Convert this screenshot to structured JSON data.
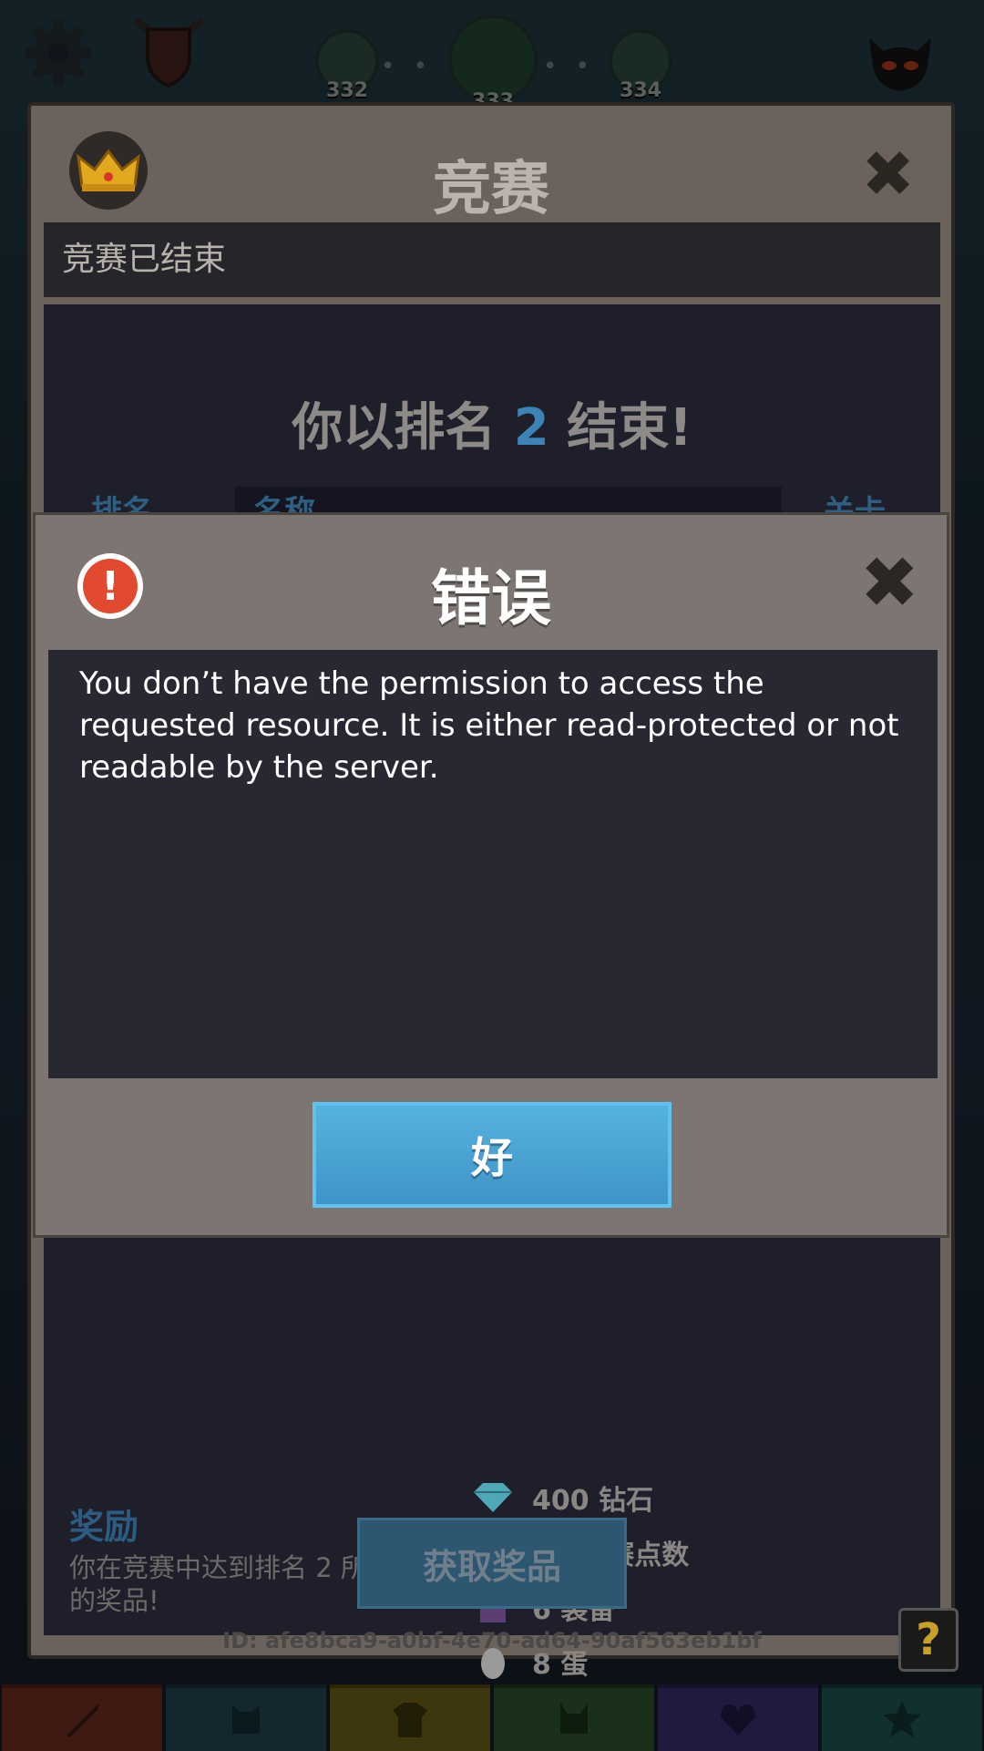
{
  "top": {
    "levels": [
      "332",
      "333",
      "334"
    ]
  },
  "contest": {
    "title": "竞赛",
    "status": "竞赛已结束",
    "result_prefix": "你以排名",
    "result_rank": "2",
    "result_suffix": "结束!",
    "columns": {
      "rank": "排名",
      "name": "名称",
      "level": "关卡"
    },
    "rewards": {
      "title": "奖励",
      "description": "你在竞赛中达到排名 2 所获得的奖品!",
      "items": [
        {
          "icon": "diamond-icon",
          "text": "400 钻石"
        },
        {
          "icon": "tournament-points-icon",
          "text": "70 竞赛点数"
        },
        {
          "icon": "shirt-icon",
          "text": "6 装备"
        },
        {
          "icon": "egg-icon",
          "text": "8 蛋"
        }
      ]
    },
    "claim_button": "获取奖品",
    "id_text": "ID: afe8bca9-a0bf-4e70-ad64-90af563eb1bf",
    "help_label": "?"
  },
  "error_dialog": {
    "title": "错误",
    "message": "You don’t have the permission to access the requested resource. It is either read-protected or not readable by the server.",
    "ok_button": "好"
  },
  "colors": {
    "accent_blue": "#4aa7d8",
    "error_red": "#e14a2e",
    "panel": "#7d7572"
  }
}
